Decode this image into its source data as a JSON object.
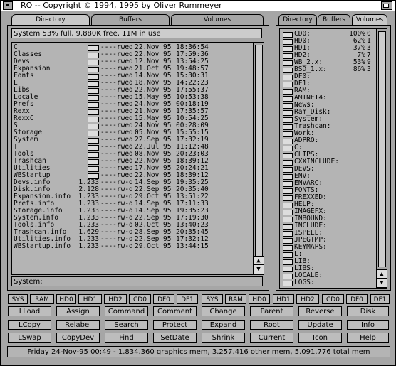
{
  "window": {
    "title": "RO -- Copyright © 1994, 1995 by Oliver Rummeyer"
  },
  "left_tabs": [
    "Directory",
    "Buffers",
    "Volumes"
  ],
  "right_tabs": [
    "Directory",
    "Buffers",
    "Volumes"
  ],
  "status": "System  53% full, 9.880K free, 11M in use",
  "path": "System:",
  "files": [
    {
      "name": "C",
      "size": "",
      "prot": "----rwed",
      "date": "22.Nov 95",
      "time": "18:36:54",
      "dir": true
    },
    {
      "name": "Classes",
      "size": "",
      "prot": "----rwed",
      "date": "22.Nov 95",
      "time": "17:59:36",
      "dir": true
    },
    {
      "name": "Devs",
      "size": "",
      "prot": "----rwed",
      "date": "12.Nov 95",
      "time": "13:54:25",
      "dir": true
    },
    {
      "name": "Expansion",
      "size": "",
      "prot": "----rwed",
      "date": "21.Oct 95",
      "time": "19:48:57",
      "dir": true
    },
    {
      "name": "Fonts",
      "size": "",
      "prot": "----rwed",
      "date": "14.Nov 95",
      "time": "15:30:31",
      "dir": true
    },
    {
      "name": "L",
      "size": "",
      "prot": "----rwed",
      "date": "18.Nov 95",
      "time": "14:22:23",
      "dir": true
    },
    {
      "name": "Libs",
      "size": "",
      "prot": "----rwed",
      "date": "22.Nov 95",
      "time": "17:55:37",
      "dir": true
    },
    {
      "name": "Locale",
      "size": "",
      "prot": "----rwed",
      "date": "15.May 95",
      "time": "10:53:38",
      "dir": true
    },
    {
      "name": "Prefs",
      "size": "",
      "prot": "----rwed",
      "date": "24.Nov 95",
      "time": "00:18:19",
      "dir": true
    },
    {
      "name": "Rexx",
      "size": "",
      "prot": "----rwed",
      "date": "21.Nov 95",
      "time": "17:35:57",
      "dir": true
    },
    {
      "name": "RexxC",
      "size": "",
      "prot": "----rwed",
      "date": "15.May 95",
      "time": "10:54:25",
      "dir": true
    },
    {
      "name": "S",
      "size": "",
      "prot": "----rwed",
      "date": "24.Nov 95",
      "time": "00:28:09",
      "dir": true
    },
    {
      "name": "Storage",
      "size": "",
      "prot": "----rwed",
      "date": "05.Nov 95",
      "time": "15:55:15",
      "dir": true
    },
    {
      "name": "System",
      "size": "",
      "prot": "----rwed",
      "date": "22.Sep 95",
      "time": "17:32:19",
      "dir": true
    },
    {
      "name": "T",
      "size": "",
      "prot": "----rwed",
      "date": "22.Jul 95",
      "time": "11:12:48",
      "dir": true
    },
    {
      "name": "Tools",
      "size": "",
      "prot": "----rwed",
      "date": "08.Nov 95",
      "time": "20:23:03",
      "dir": true
    },
    {
      "name": "Trashcan",
      "size": "",
      "prot": "----rwed",
      "date": "22.Nov 95",
      "time": "18:39:12",
      "dir": true
    },
    {
      "name": "Utilities",
      "size": "",
      "prot": "----rwed",
      "date": "17.Nov 95",
      "time": "20:24:21",
      "dir": true
    },
    {
      "name": "WBStartup",
      "size": "",
      "prot": "----rwed",
      "date": "22.Nov 95",
      "time": "18:39:12",
      "dir": true
    },
    {
      "name": "Devs.info",
      "size": "1.233",
      "prot": "----rw-d",
      "date": "14.Sep 95",
      "time": "19:35:25",
      "dir": false
    },
    {
      "name": "Disk.info",
      "size": "2.128",
      "prot": "----rw-d",
      "date": "22.Sep 95",
      "time": "20:35:40",
      "dir": false
    },
    {
      "name": "Expansion.info",
      "size": "1.233",
      "prot": "----rw-d",
      "date": "29.Oct 95",
      "time": "13:51:22",
      "dir": false
    },
    {
      "name": "Prefs.info",
      "size": "1.233",
      "prot": "----rw-d",
      "date": "14.Sep 95",
      "time": "17:11:33",
      "dir": false
    },
    {
      "name": "Storage.info",
      "size": "1.233",
      "prot": "----rw-d",
      "date": "14.Sep 95",
      "time": "19:35:23",
      "dir": false
    },
    {
      "name": "System.info",
      "size": "1.233",
      "prot": "----rw-d",
      "date": "22.Sep 95",
      "time": "17:19:30",
      "dir": false
    },
    {
      "name": "Tools.info",
      "size": "1.233",
      "prot": "----rw-d",
      "date": "02.Oct 95",
      "time": "13:40:23",
      "dir": false
    },
    {
      "name": "Trashcan.info",
      "size": "1.629",
      "prot": "----rw-d",
      "date": "28.Sep 95",
      "time": "20:35:45",
      "dir": false
    },
    {
      "name": "Utilities.info",
      "size": "1.233",
      "prot": "----rw-d",
      "date": "22.Sep 95",
      "time": "17:32:12",
      "dir": false
    },
    {
      "name": "WBStartup.info",
      "size": "1.233",
      "prot": "----rw-d",
      "date": "29.Oct 95",
      "time": "13:44:15",
      "dir": false
    }
  ],
  "volumes": [
    {
      "name": "CD0:",
      "pct": "100%",
      "n": "0"
    },
    {
      "name": "HD0:",
      "pct": "62%",
      "n": "1"
    },
    {
      "name": "HD1:",
      "pct": "37%",
      "n": "3"
    },
    {
      "name": "HD2:",
      "pct": "7%",
      "n": "7"
    },
    {
      "name": "WB_2.x:",
      "pct": "53%",
      "n": "9"
    },
    {
      "name": "BSD_1.x:",
      "pct": "86%",
      "n": "3"
    },
    {
      "name": "DF0:",
      "pct": "",
      "n": ""
    },
    {
      "name": "DF1:",
      "pct": "",
      "n": ""
    },
    {
      "name": "RAM:",
      "pct": "",
      "n": ""
    },
    {
      "name": "AMINET4:",
      "pct": "",
      "n": ""
    },
    {
      "name": "News:",
      "pct": "",
      "n": ""
    },
    {
      "name": "Ram_Disk:",
      "pct": "",
      "n": ""
    },
    {
      "name": "System:",
      "pct": "",
      "n": ""
    },
    {
      "name": "Trashcan:",
      "pct": "",
      "n": ""
    },
    {
      "name": "Work:",
      "pct": "",
      "n": ""
    },
    {
      "name": "ADPRO:",
      "pct": "",
      "n": ""
    },
    {
      "name": "C:",
      "pct": "",
      "n": ""
    },
    {
      "name": "CLIPS:",
      "pct": "",
      "n": ""
    },
    {
      "name": "CXXINCLUDE:",
      "pct": "",
      "n": ""
    },
    {
      "name": "DEVS:",
      "pct": "",
      "n": ""
    },
    {
      "name": "ENV:",
      "pct": "",
      "n": ""
    },
    {
      "name": "ENVARC:",
      "pct": "",
      "n": ""
    },
    {
      "name": "FONTS:",
      "pct": "",
      "n": ""
    },
    {
      "name": "FREXXED:",
      "pct": "",
      "n": ""
    },
    {
      "name": "HELP:",
      "pct": "",
      "n": ""
    },
    {
      "name": "IMAGEFX:",
      "pct": "",
      "n": ""
    },
    {
      "name": "INBOUND:",
      "pct": "",
      "n": ""
    },
    {
      "name": "INCLUDE:",
      "pct": "",
      "n": ""
    },
    {
      "name": "ISPELL:",
      "pct": "",
      "n": ""
    },
    {
      "name": "JPEGTMP:",
      "pct": "",
      "n": ""
    },
    {
      "name": "KEYMAPS:",
      "pct": "",
      "n": ""
    },
    {
      "name": "L:",
      "pct": "",
      "n": ""
    },
    {
      "name": "LIB:",
      "pct": "",
      "n": ""
    },
    {
      "name": "LIBS:",
      "pct": "",
      "n": ""
    },
    {
      "name": "LOCALE:",
      "pct": "",
      "n": ""
    },
    {
      "name": "LOGS:",
      "pct": "",
      "n": ""
    }
  ],
  "drive_buttons": [
    "SYS",
    "RAM",
    "HD0",
    "HD1",
    "HD2",
    "CD0",
    "DF0",
    "DF1",
    "SYS",
    "RAM",
    "HD0",
    "HD1",
    "HD2",
    "CD0",
    "DF0",
    "DF1"
  ],
  "action_rows": [
    [
      "LLoad",
      "Assign",
      "Command",
      "Comment",
      "Change",
      "Parent",
      "Reverse",
      "Disk"
    ],
    [
      "LCopy",
      "Relabel",
      "Search",
      "Protect",
      "Expand",
      "Root",
      "Update",
      "Info"
    ],
    [
      "LSwap",
      "CopyDev",
      "Find",
      "SetDate",
      "Shrink",
      "Current",
      "Icon",
      "Help"
    ]
  ],
  "footer": "Friday 24-Nov-95 00:49 - 1.834.360 graphics mem, 3.257.416 other mem, 5.091.776 total mem"
}
